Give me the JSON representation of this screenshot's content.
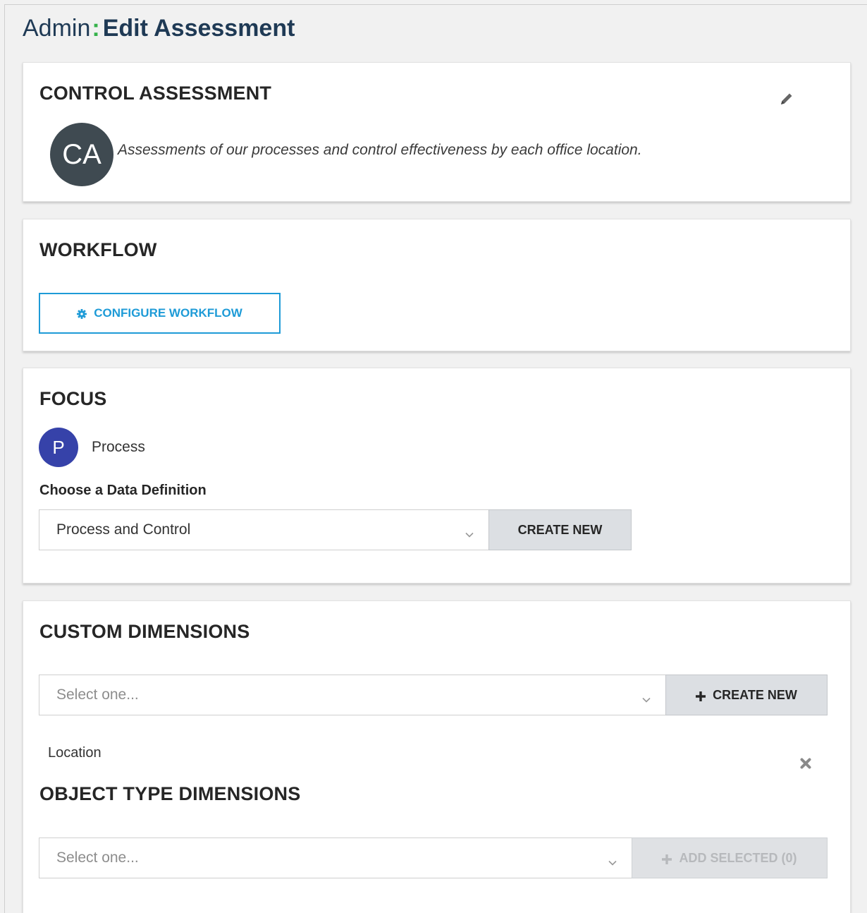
{
  "header": {
    "admin": "Admin",
    "separator": ":",
    "title": "Edit Assessment"
  },
  "assessment": {
    "title": "CONTROL ASSESSMENT",
    "avatar_initials": "CA",
    "description": "Assessments of our processes and control effectiveness by each office location.",
    "edit_icon": "pencil-icon"
  },
  "workflow": {
    "title": "WORKFLOW",
    "button_label": "CONFIGURE WORKFLOW",
    "button_icon": "gear-icon"
  },
  "focus": {
    "title": "FOCUS",
    "avatar_initial": "P",
    "focus_name": "Process",
    "data_definition_label": "Choose a Data Definition",
    "data_definition_value": "Process and Control",
    "create_new_label": "CREATE NEW"
  },
  "custom_dimensions": {
    "title": "CUSTOM DIMENSIONS",
    "select_placeholder": "Select one...",
    "create_new_label": "CREATE NEW",
    "items": [
      {
        "label": "Location"
      }
    ]
  },
  "object_type_dimensions": {
    "title": "OBJECT TYPE DIMENSIONS",
    "select_placeholder": "Select one...",
    "add_selected_label": "ADD SELECTED (0)"
  },
  "colors": {
    "brand_navy": "#1f3a55",
    "brand_green": "#35b24a",
    "accent_blue": "#1e9bd7",
    "avatar_ca": "#3f4a51",
    "avatar_p": "#3642a9"
  }
}
